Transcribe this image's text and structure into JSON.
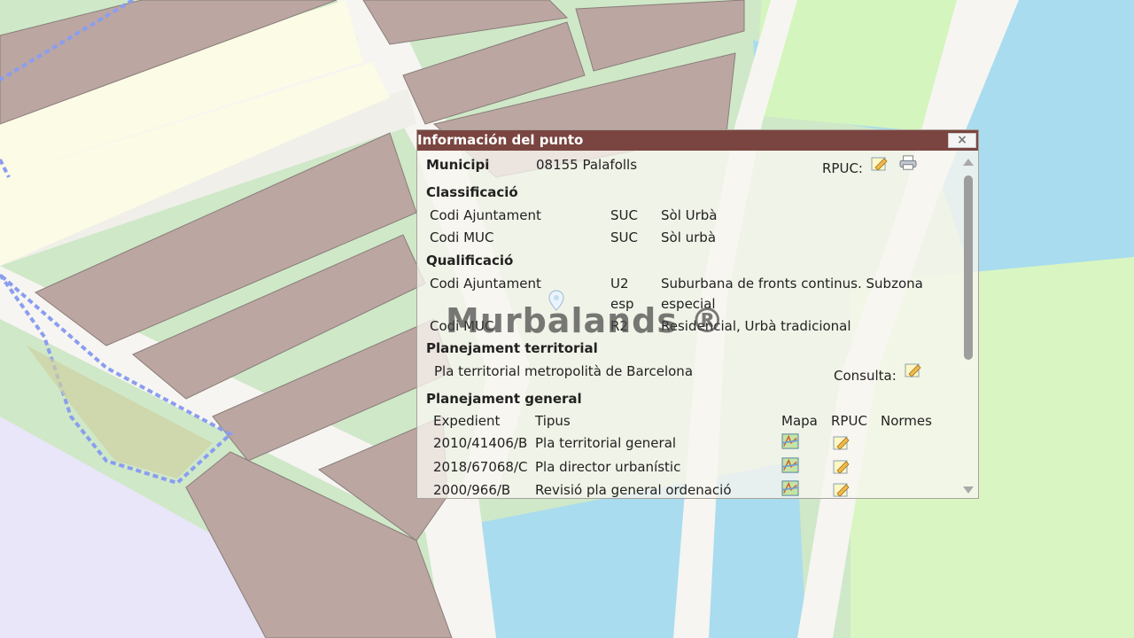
{
  "popup": {
    "title": "Información del punto",
    "close_label": "×",
    "municipi_label": "Municipi",
    "municipi_value": "08155 Palafolls",
    "rpuc_label": "RPUC:",
    "classificacio": {
      "heading": "Classificació",
      "rows": [
        {
          "label": "Codi Ajuntament",
          "code": "SUC",
          "desc": "Sòl Urbà"
        },
        {
          "label": "Codi MUC",
          "code": "SUC",
          "desc": "Sòl urbà"
        }
      ]
    },
    "qualificacio": {
      "heading": "Qualificació",
      "rows": [
        {
          "label": "Codi Ajuntament",
          "code_line1": "U2",
          "code_line2": "esp",
          "desc_line1": "Suburbana de fronts continus. Subzona",
          "desc_line2": "especial"
        },
        {
          "label": "Codi MUC",
          "code": "R2",
          "desc": "Residencial, Urbà tradicional"
        }
      ]
    },
    "planejament_territorial": {
      "heading": "Planejament territorial",
      "plan": "Pla territorial metropolità de Barcelona",
      "consulta_label": "Consulta:"
    },
    "planejament_general": {
      "heading": "Planejament general",
      "headers": {
        "expedient": "Expedient",
        "tipus": "Tipus",
        "mapa": "Mapa",
        "rpuc": "RPUC",
        "normes": "Normes"
      },
      "rows": [
        {
          "expedient": "2010/41406/B",
          "tipus": "Pla territorial general"
        },
        {
          "expedient": "2018/67068/C",
          "tipus": "Pla director urbanístic"
        },
        {
          "expedient": "2000/966/B",
          "tipus": "Revisió pla general ordenació"
        }
      ]
    }
  },
  "watermark": "Murbalands ®",
  "icons": {
    "close": "close-icon",
    "edit": "edit-icon",
    "print": "print-icon",
    "map": "map-icon",
    "location_pin": "location-pin-icon"
  },
  "colors": {
    "title_bar": "#7a4540",
    "building": "#bba6a2",
    "road": "#f7f6f2",
    "water": "#a9dcee",
    "park": "#d4f5bd",
    "boundary": "#8a9df0"
  }
}
